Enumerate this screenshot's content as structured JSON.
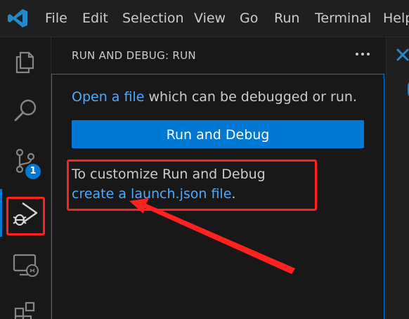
{
  "menu": {
    "items": [
      "File",
      "Edit",
      "Selection",
      "View",
      "Go",
      "Run",
      "Terminal",
      "Help"
    ]
  },
  "activity_bar": {
    "icons": [
      "files-icon",
      "search-icon",
      "source-control-icon",
      "run-debug-icon",
      "remote-explorer-icon",
      "extensions-icon"
    ],
    "scm_badge": "1"
  },
  "sidebar": {
    "title": "RUN AND DEBUG: RUN",
    "more_label": "···",
    "open_file_link": "Open a file",
    "open_file_rest": " which can be debugged or run.",
    "run_button_label": "Run and Debug",
    "customize_prefix": "To customize Run and Debug ",
    "customize_link": "create a launch.json file",
    "customize_suffix": "."
  },
  "colors": {
    "accent": "#0078d4",
    "link": "#4daafc",
    "annotation": "#ff2020",
    "background": "#181818",
    "text": "#cccccc"
  }
}
